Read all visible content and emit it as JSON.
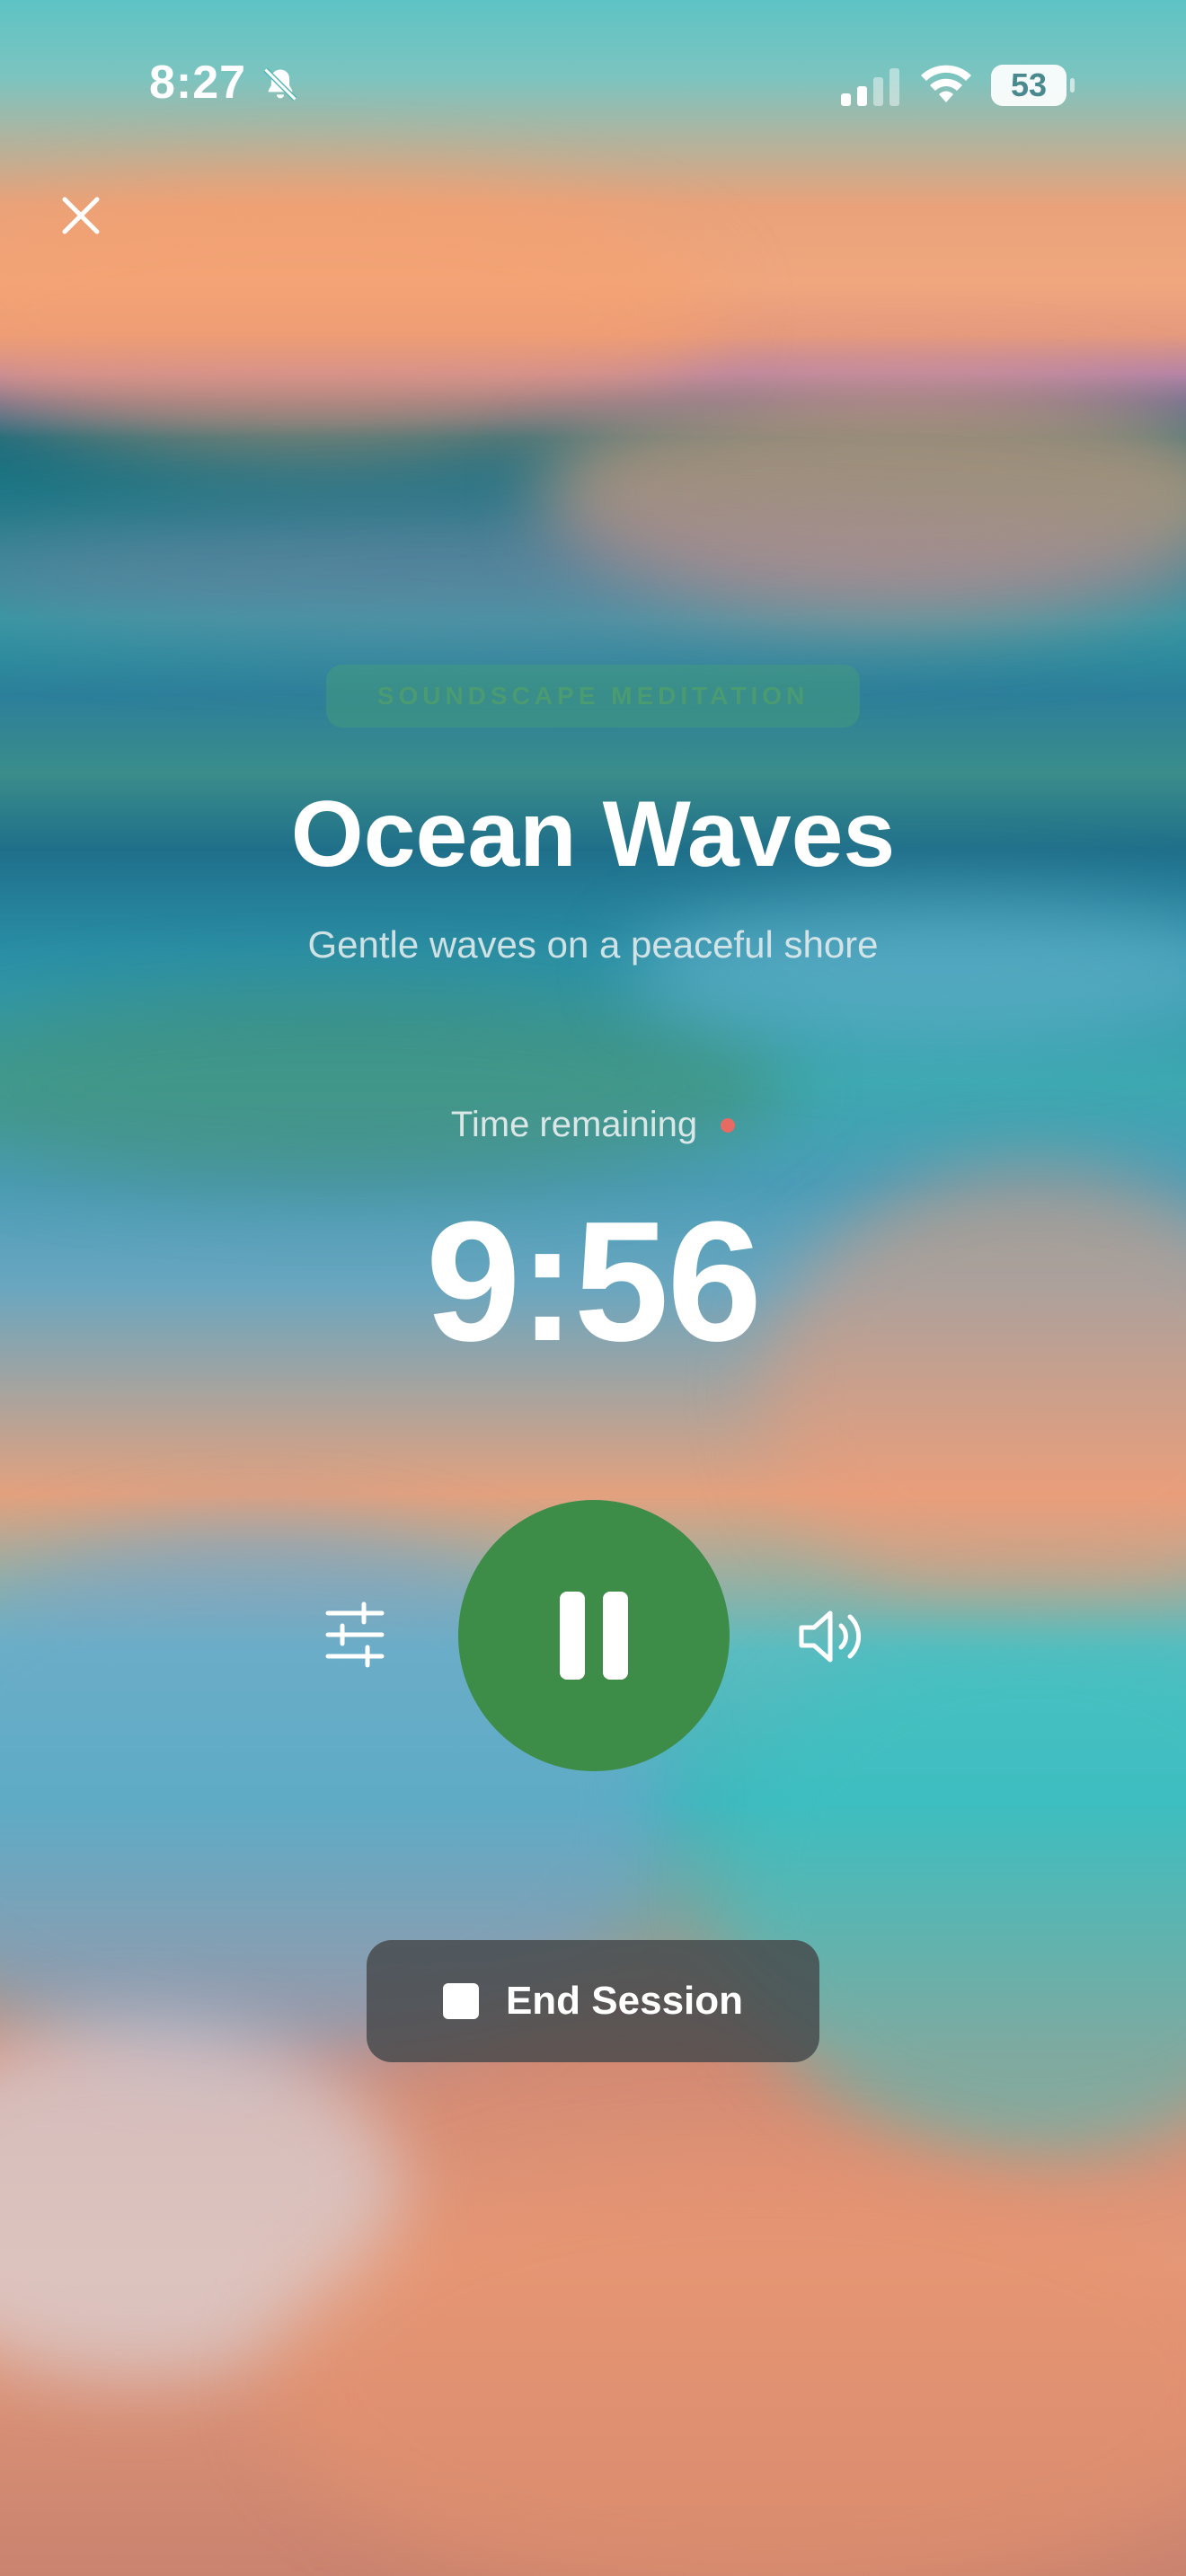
{
  "status_bar": {
    "time": "8:27",
    "battery_level": "53"
  },
  "session": {
    "category": "SOUNDSCAPE MEDITATION",
    "title": "Ocean Waves",
    "subtitle": "Gentle waves on a peaceful shore",
    "time_label": "Time remaining",
    "time_remaining": "9:56"
  },
  "actions": {
    "end_session_label": "End Session"
  },
  "colors": {
    "accent_green": "#3d8c48",
    "live_dot": "#e86b63"
  },
  "icons": {
    "close": "close-icon",
    "silent": "bell-slash-icon",
    "signal": "cellular-signal-icon",
    "wifi": "wifi-icon",
    "adjust": "sliders-icon",
    "pause": "pause-icon",
    "volume": "speaker-icon",
    "stop": "stop-icon"
  }
}
